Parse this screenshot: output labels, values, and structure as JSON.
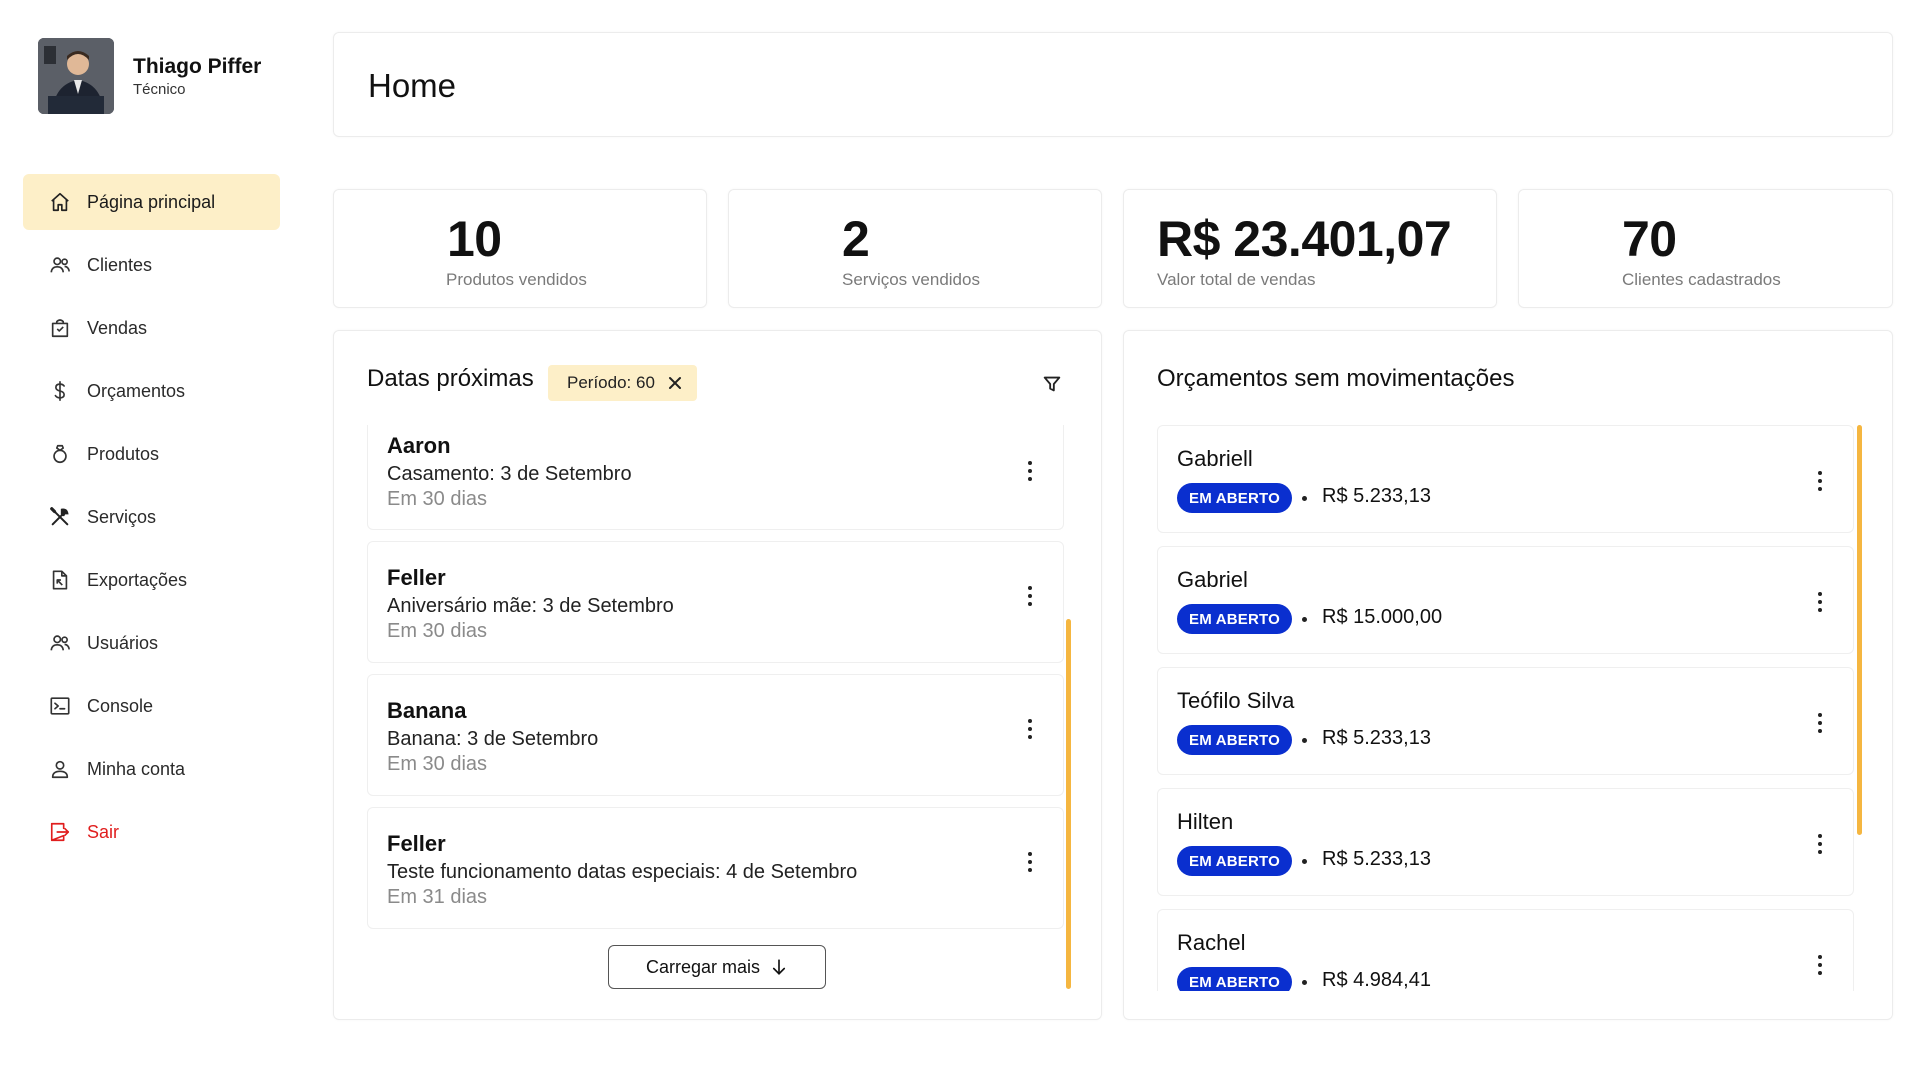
{
  "profile": {
    "name": "Thiago Piffer",
    "role": "Técnico"
  },
  "nav": [
    {
      "label": "Página principal",
      "icon": "home-icon",
      "active": true
    },
    {
      "label": "Clientes",
      "icon": "users-icon"
    },
    {
      "label": "Vendas",
      "icon": "shopping-bag-icon"
    },
    {
      "label": "Orçamentos",
      "icon": "dollar-icon"
    },
    {
      "label": "Produtos",
      "icon": "ring-icon"
    },
    {
      "label": "Serviços",
      "icon": "tools-icon"
    },
    {
      "label": "Exportações",
      "icon": "file-export-icon"
    },
    {
      "label": "Usuários",
      "icon": "users-icon"
    },
    {
      "label": "Console",
      "icon": "terminal-icon"
    },
    {
      "label": "Minha conta",
      "icon": "user-icon"
    },
    {
      "label": "Sair",
      "icon": "logout-icon",
      "color": "#e01e1e"
    }
  ],
  "header": {
    "title": "Home"
  },
  "stats": [
    {
      "value": "10",
      "label": "Produtos vendidos"
    },
    {
      "value": "2",
      "label": "Serviços vendidos"
    },
    {
      "value": "R$ 23.401,07",
      "label": "Valor total de vendas"
    },
    {
      "value": "70",
      "label": "Clientes cadastrados"
    }
  ],
  "dates_panel": {
    "title": "Datas próximas",
    "filter_chip": "Período: 60",
    "load_more": "Carregar mais",
    "events": [
      {
        "name": "Aaron",
        "description": "Casamento: 3 de Setembro",
        "when": "Em 30 dias"
      },
      {
        "name": "Feller",
        "description": "Aniversário mãe: 3 de Setembro",
        "when": "Em 30 dias"
      },
      {
        "name": "Banana",
        "description": "Banana: 3 de Setembro",
        "when": "Em 30 dias"
      },
      {
        "name": "Feller",
        "description": "Teste funcionamento datas especiais: 4 de Setembro",
        "when": "Em 31 dias"
      }
    ]
  },
  "quotes_panel": {
    "title": "Orçamentos sem movimentações",
    "quotes": [
      {
        "name": "Gabriell",
        "status": "EM ABERTO",
        "value": "R$ 5.233,13"
      },
      {
        "name": "Gabriel",
        "status": "EM ABERTO",
        "value": "R$ 15.000,00"
      },
      {
        "name": "Teófilo Silva",
        "status": "EM ABERTO",
        "value": "R$ 5.233,13"
      },
      {
        "name": "Hilten",
        "status": "EM ABERTO",
        "value": "R$ 5.233,13"
      },
      {
        "name": "Rachel",
        "status": "EM ABERTO",
        "value": "R$ 4.984,41"
      }
    ]
  },
  "colors": {
    "accent": "#fdefc8",
    "scrollbar": "#f5b640",
    "badge": "#0a2fcf",
    "danger": "#e01e1e"
  }
}
